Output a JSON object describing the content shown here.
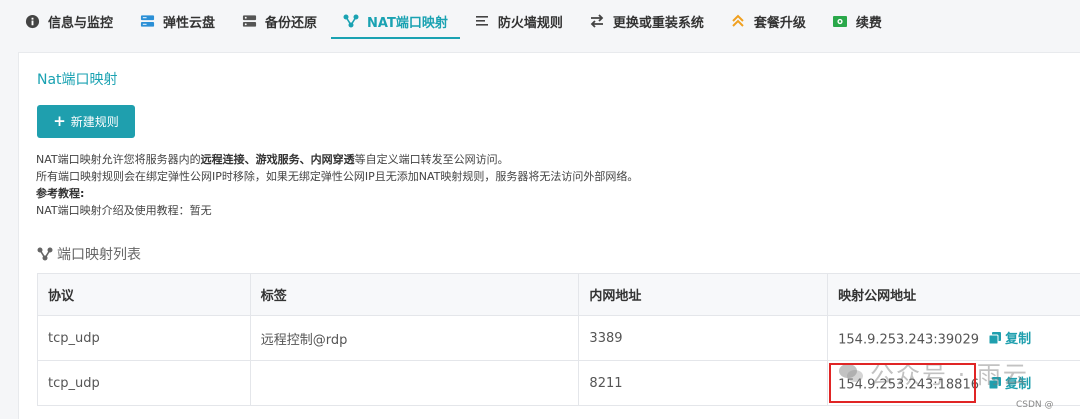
{
  "tabs": [
    {
      "label": "信息与监控",
      "icon": "info-icon",
      "active": false
    },
    {
      "label": "弹性云盘",
      "icon": "disk-icon",
      "active": false
    },
    {
      "label": "备份还原",
      "icon": "backup-icon",
      "active": false
    },
    {
      "label": "NAT端口映射",
      "icon": "nat-icon",
      "active": true
    },
    {
      "label": "防火墙规则",
      "icon": "list-icon",
      "active": false
    },
    {
      "label": "更换或重装系统",
      "icon": "swap-icon",
      "active": false
    },
    {
      "label": "套餐升级",
      "icon": "upgrade-icon",
      "active": false
    },
    {
      "label": "续费",
      "icon": "renew-icon",
      "active": false
    }
  ],
  "panel": {
    "title": "Nat端口映射",
    "new_rule_button": "新建规则",
    "desc_line1_pre": "NAT端口映射允许您将服务器内的",
    "desc_line1_bold": "远程连接、游戏服务、内网穿透",
    "desc_line1_post": "等自定义端口转发至公网访问。",
    "desc_line2": "所有端口映射规则会在绑定弹性公网IP时移除，如果无绑定弹性公网IP且无添加NAT映射规则，服务器将无法访问外部网络。",
    "desc_line3": "参考教程:",
    "desc_line4": "NAT端口映射介绍及使用教程：暂无"
  },
  "list": {
    "title": "端口映射列表",
    "columns": [
      "协议",
      "标签",
      "内网地址",
      "映射公网地址"
    ],
    "copy_label": "复制",
    "rows": [
      {
        "protocol": "tcp_udp",
        "tag": "远程控制@rdp",
        "internal": "3389",
        "public": "154.9.253.243:39029"
      },
      {
        "protocol": "tcp_udp",
        "tag": "",
        "internal": "8211",
        "public": "154.9.253.243:18816"
      }
    ]
  },
  "watermark": "公众号 · 雨云",
  "csdn": "CSDN @"
}
